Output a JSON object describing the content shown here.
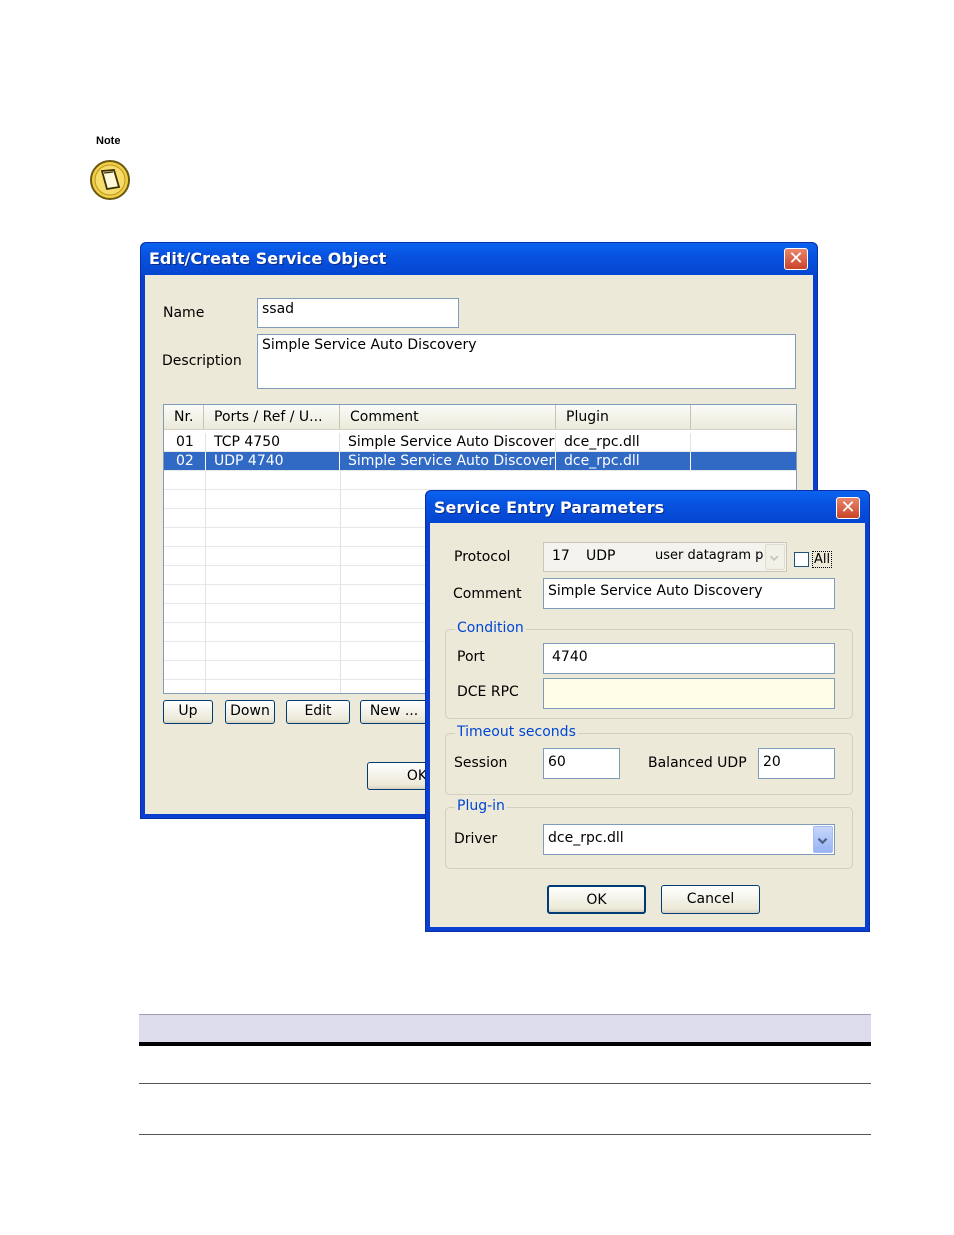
{
  "note": {
    "label": "Note",
    "icon": "note-pencil-icon"
  },
  "main_window": {
    "title": "Edit/Create Service Object",
    "name_label": "Name",
    "name_value": "ssad",
    "description_label": "Description",
    "description_value": "Simple Service Auto Discovery",
    "columns": [
      "Nr.",
      "Ports / Ref / U...",
      "Comment",
      "Plugin"
    ],
    "rows": [
      {
        "nr": "01",
        "ports": "TCP  4750",
        "comment": "Simple Service Auto Discovery",
        "plugin": "dce_rpc.dll",
        "selected": false
      },
      {
        "nr": "02",
        "ports": "UDP  4740",
        "comment": "Simple Service Auto Discovery",
        "plugin": "dce_rpc.dll",
        "selected": true
      }
    ],
    "buttons": {
      "up": "Up",
      "down": "Down",
      "edit": "Edit",
      "new": "New ...",
      "ok": "OK"
    }
  },
  "entry_dialog": {
    "title": "Service Entry Parameters",
    "protocol_label": "Protocol",
    "protocol_number": "17",
    "protocol_name": "UDP",
    "protocol_desc": "user datagram p",
    "all_label": "All",
    "comment_label": "Comment",
    "comment_value": "Simple Service Auto Discovery",
    "condition_title": "Condition",
    "port_label": "Port",
    "port_value": "4740",
    "dce_rpc_label": "DCE RPC",
    "dce_rpc_value": "",
    "timeout_title": "Timeout seconds",
    "session_label": "Session",
    "session_value": "60",
    "balanced_label": "Balanced UDP",
    "balanced_value": "20",
    "plugin_title": "Plug-in",
    "driver_label": "Driver",
    "driver_value": "dce_rpc.dll",
    "ok": "OK",
    "cancel": "Cancel"
  },
  "colors": {
    "titlebar": "#0852e0",
    "selection": "#316ac5",
    "dialog_bg": "#ece9d8",
    "group_title": "#0046d5"
  }
}
